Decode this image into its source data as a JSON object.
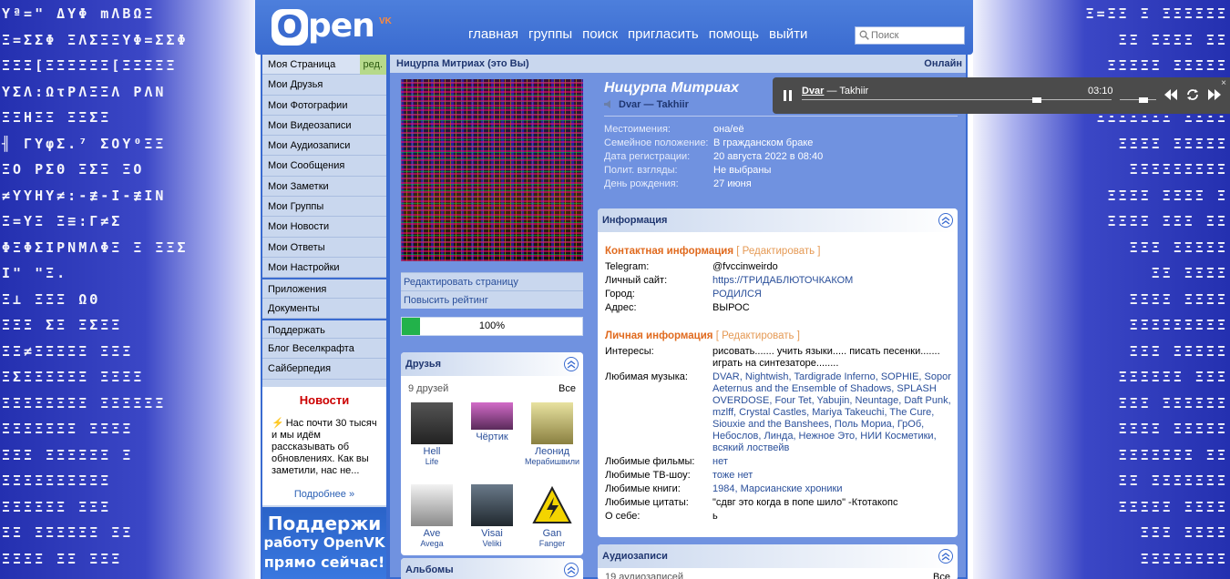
{
  "background": {
    "left_rows": [
      "Yª=\" ΔYΦ mΛΒΩΞ",
      "Ξ=ΣΣΦ ΞΛΣΞΞΥΦ=ΣΣΦ",
      "ΞΞΞ[ΞΞΞΞΞΞ[ΞΞΞΞΞ",
      "ΥΣΛ:ΩτΡΛΞΞΛ ΡΛΝ",
      "ΞΞΗΞΞ ΞΞΣΞ",
      "╢ ΓΥφΣ.⁷ ΣΟΥ⁰ΞΞ",
      "ΞΟ ΡΣΘ ΞΣΞ ΞΟ",
      "≠ΥΥΗΥ≠:-≢-Ι-≢ΙΝ",
      "Ξ=ΥΞ Ξ≡:Γ≠Σ",
      "ΦΞΦΣΙΡΝΜΛΦΞ Ξ ΞΞΣ",
      "Ι\" \"Ξ.",
      "Ξ⊥ ΞΞΞ  ΩΘ",
      "ΞΞΞ ΣΞ ΞΣΞΞ",
      "ΞΞ≠ΞΞΞΞΞ ΞΞΞ",
      "ΞΣΞΞΞΞΞΞ ΞΞΞΞ",
      "ΞΞΞΞΞΞΞΞ ΞΞΞΞΞΞ",
      "ΞΞΞΞΞΞΞ ΞΞΞΞ",
      "ΞΞΞ ΞΞΞΞΞΞ Ξ",
      "ΞΞΞΞΞΞΞΞΞΞ",
      "ΞΞΞΞΞΞ ΞΞΞ",
      "ΞΞ ΞΞΞΞΞΞ ΞΞ",
      "ΞΞΞΞ ΞΞ ΞΞΞ"
    ],
    "right_rows": [
      "Ξ=ΞΞ Ξ ΞΞΞΞΞΞ",
      "ΞΞ ΞΞΞΞ ΞΞ",
      "ΞΞΞΞΞ ΞΞΞΞΞ",
      "ΞΞΞΞΞ ΞΞ ΞΞΞ",
      "ΞΞΞΞΞΞΞ ΞΞΞΞ",
      "ΞΞΞΞ ΞΞΞΞΞ",
      "ΞΞΞΞΞΞΞΞΞ",
      "ΞΞΞΞ ΞΞΞΞ Ξ",
      "ΞΞΞΞ ΞΞΞ ΞΞ",
      "ΞΞΞ ΞΞΞΞΞ",
      "ΞΞ ΞΞΞΞ",
      "ΞΞΞΞ ΞΞΞΞ",
      "ΞΞΞΞΞΞΞΞΞ",
      "ΞΞΞ ΞΞΞΞΞ",
      "ΞΞΞΞΞΞ ΞΞΞ",
      "ΞΞΞ ΞΞΞΞΞΞ",
      "ΞΞΞΞ ΞΞΞΞΞ",
      "ΞΞΞΞΞΞΞ ΞΞ",
      "ΞΞ ΞΞΞΞΞΞΞ",
      "ΞΞΞΞΞ ΞΞΞΞ",
      "ΞΞΞ ΞΞΞΞ",
      "ΞΞΞΞΞΞΞΞ"
    ]
  },
  "header": {
    "logo_o": "O",
    "logo_pen": "pen",
    "logo_vk": "VK",
    "nav": [
      "главная",
      "группы",
      "поиск",
      "пригласить",
      "помощь",
      "выйти"
    ],
    "search_placeholder": "Поиск"
  },
  "sidebar": {
    "items": [
      "Моя Страница",
      "Мои Друзья",
      "Мои Фотографии",
      "Мои Видеозаписи",
      "Мои Аудиозаписи",
      "Мои Сообщения",
      "Мои Заметки",
      "Мои Группы",
      "Мои Новости",
      "Мои Ответы",
      "Мои Настройки",
      "Приложения",
      "Документы",
      "Поддержать",
      "Блог Веселкрафта",
      "Сайберпедия"
    ],
    "edit_badge": "ред.",
    "news_title": "Новости",
    "news_text": "Нас почти 30 тысяч и мы идём рассказывать об обновлениях. Как вы заметили, нас не...",
    "news_more": "Подробнее »",
    "promo_lines": [
      "Поддержи",
      "работу OpenVK",
      "прямо сейчас!"
    ]
  },
  "main": {
    "title": "Ницурпа Митриах (это Вы)",
    "online": "Онлайн",
    "edit_page": "Редактировать страницу",
    "raise_rating": "Повысить рейтинг",
    "rating": "100%",
    "rating_value": 1.0,
    "friends": {
      "title": "Друзья",
      "count": "9 друзей",
      "all": "Все",
      "list": [
        {
          "name": "Hell",
          "sub": "Life"
        },
        {
          "name": "Чёртик",
          "sub": ""
        },
        {
          "name": "Леонид",
          "sub": "Мерабишвили"
        },
        {
          "name": "Ave",
          "sub": "Avega"
        },
        {
          "name": "Visai",
          "sub": "Veliki"
        },
        {
          "name": "Gan",
          "sub": "Fanger"
        }
      ]
    },
    "albums_title": "Альбомы"
  },
  "profile": {
    "name": "Ницурпа Митриах",
    "status_artist": "Dvar",
    "status_sep": " — ",
    "status_track": "Takhiir",
    "fields": [
      {
        "k": "Местоимения:",
        "v": "она/её"
      },
      {
        "k": "Семейное положение:",
        "v": "В гражданском браке"
      },
      {
        "k": "Дата регистрации:",
        "v": "20 августа 2022 в 08:40"
      },
      {
        "k": "Полит. взгляды:",
        "v": "Не выбраны"
      },
      {
        "k": "День рождения:",
        "v": "27 июня"
      }
    ]
  },
  "info": {
    "title": "Информация",
    "contact_title": "Контактная информация",
    "personal_title": "Личная информация",
    "edit": "[ Редактировать ]",
    "contact": [
      {
        "k": "Telegram:",
        "v": "@fvccinweirdo"
      },
      {
        "k": "Личный сайт:",
        "v": "https://ТРИДАБЛЮТОЧКАКОМ"
      },
      {
        "k": "Город:",
        "v": "РОДИЛСЯ"
      },
      {
        "k": "Адрес:",
        "v": "ВЫРОС"
      }
    ],
    "personal": [
      {
        "k": "Интересы:",
        "v": "рисовать....... учить языки..... писать песенки....... играть на синтезаторе........"
      },
      {
        "k": "Любимая музыка:",
        "v": "DVAR, Nightwish, Tardigrade Inferno, SOPHIE, Sopor Aeternus and the Ensemble of Shadows, SPLASH OVERDOSE, Four Tet, Yabujin, Neuntage, Daft Punk, mzlff, Crystal Castles, Mariya Takeuchi, The Cure, Siouxie and the Banshees, Поль Мориа, ГрОб, Небослов, Линда, Нежное Это, НИИ Косметики, всякий лоствейв"
      },
      {
        "k": "Любимые фильмы:",
        "v": "нет"
      },
      {
        "k": "Любимые ТВ-шоу:",
        "v": "тоже нет"
      },
      {
        "k": "Любимые книги:",
        "v": "1984, Марсианские хроники"
      },
      {
        "k": "Любимые цитаты:",
        "v": "\"сдвг это когда в попе шило\" -Ктотакопс"
      },
      {
        "k": "О себе:",
        "v": "ь"
      }
    ]
  },
  "audio": {
    "title": "Аудиозаписи",
    "count": "19 аудиозаписей",
    "all": "Все"
  },
  "player": {
    "artist": "Dvar",
    "sep": " — ",
    "track": "Takhiir",
    "time": "03:10",
    "progress": 0.76,
    "volume": 0.45,
    "close": "×"
  },
  "colors": {
    "accent": "#3a6bd0",
    "panel": "#7092e0",
    "section_orange": "#e06a1e",
    "rating_green": "#22b24a"
  }
}
